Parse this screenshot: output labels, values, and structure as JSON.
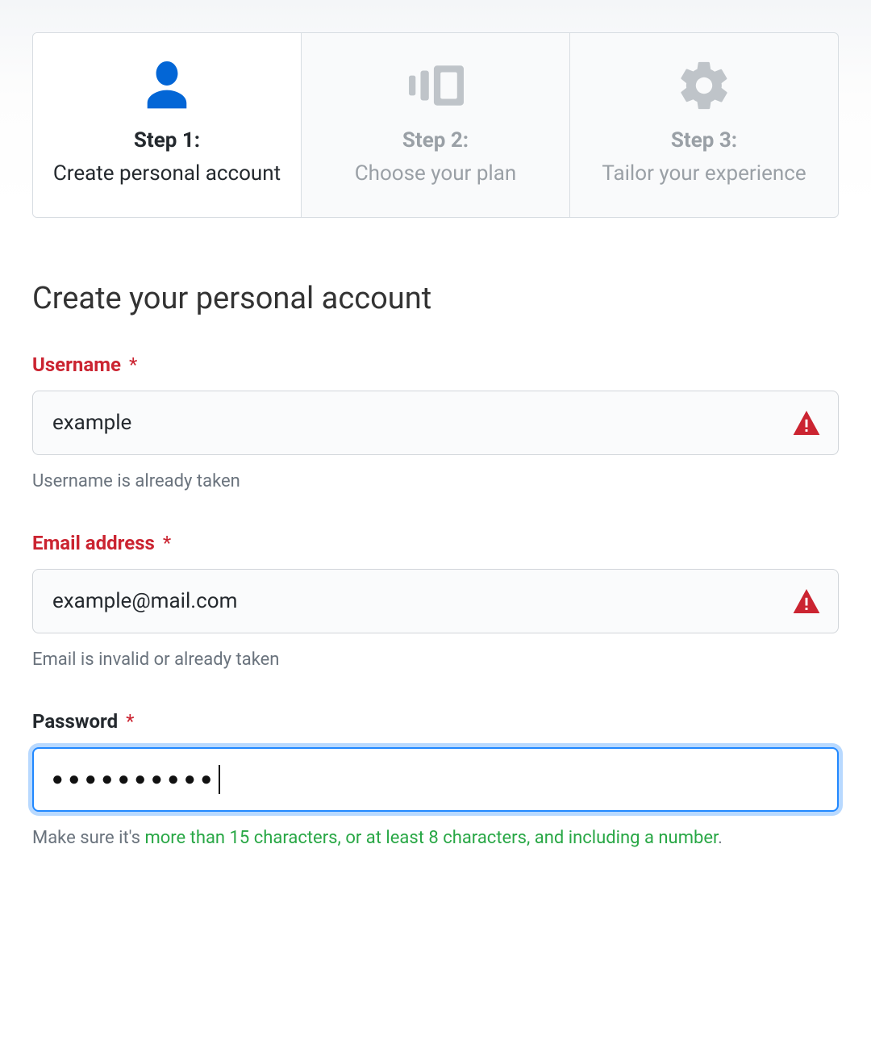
{
  "steps": [
    {
      "title": "Step 1:",
      "desc": "Create personal account",
      "active": true
    },
    {
      "title": "Step 2:",
      "desc": "Choose your plan",
      "active": false
    },
    {
      "title": "Step 3:",
      "desc": "Tailor your experience",
      "active": false
    }
  ],
  "heading": "Create your personal account",
  "required_mark": "*",
  "fields": {
    "username": {
      "label": "Username",
      "value": "example",
      "help": "Username is already taken",
      "error": true
    },
    "email": {
      "label": "Email address",
      "value": "example@mail.com",
      "help": "Email is invalid or already taken",
      "error": true
    },
    "password": {
      "label": "Password",
      "mask": "●●●●●●●●●●",
      "error": false,
      "help_prefix": "Make sure it's ",
      "help_rule1": "more than 15 characters",
      "help_sep1": ", ",
      "help_rule2": "or at least 8 characters",
      "help_sep2": ", ",
      "help_rule3": "and including a number",
      "help_suffix": "."
    }
  }
}
